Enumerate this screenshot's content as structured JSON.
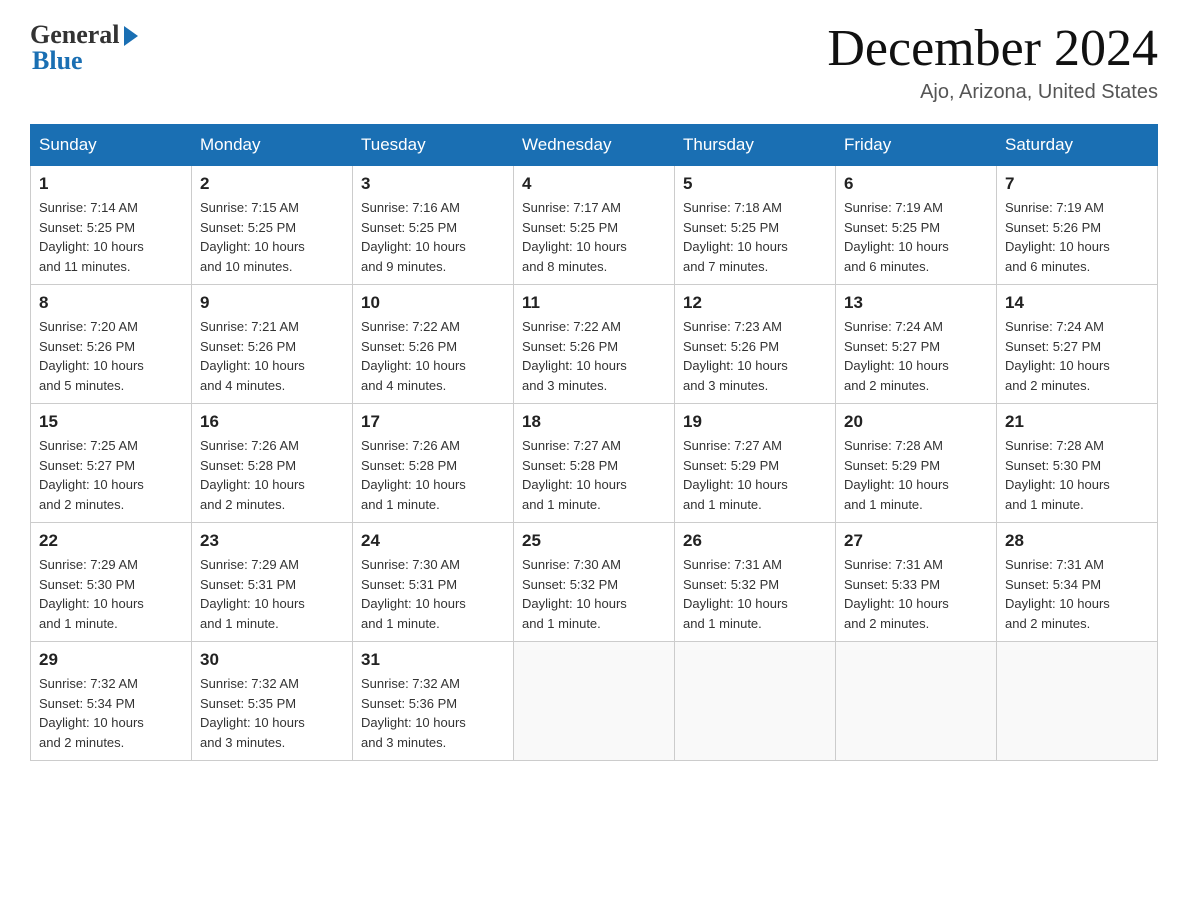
{
  "header": {
    "logo_general": "General",
    "logo_blue": "Blue",
    "month_title": "December 2024",
    "location": "Ajo, Arizona, United States"
  },
  "days_of_week": [
    "Sunday",
    "Monday",
    "Tuesday",
    "Wednesday",
    "Thursday",
    "Friday",
    "Saturday"
  ],
  "weeks": [
    [
      {
        "day": "1",
        "sunrise": "7:14 AM",
        "sunset": "5:25 PM",
        "daylight": "10 hours and 11 minutes."
      },
      {
        "day": "2",
        "sunrise": "7:15 AM",
        "sunset": "5:25 PM",
        "daylight": "10 hours and 10 minutes."
      },
      {
        "day": "3",
        "sunrise": "7:16 AM",
        "sunset": "5:25 PM",
        "daylight": "10 hours and 9 minutes."
      },
      {
        "day": "4",
        "sunrise": "7:17 AM",
        "sunset": "5:25 PM",
        "daylight": "10 hours and 8 minutes."
      },
      {
        "day": "5",
        "sunrise": "7:18 AM",
        "sunset": "5:25 PM",
        "daylight": "10 hours and 7 minutes."
      },
      {
        "day": "6",
        "sunrise": "7:19 AM",
        "sunset": "5:25 PM",
        "daylight": "10 hours and 6 minutes."
      },
      {
        "day": "7",
        "sunrise": "7:19 AM",
        "sunset": "5:26 PM",
        "daylight": "10 hours and 6 minutes."
      }
    ],
    [
      {
        "day": "8",
        "sunrise": "7:20 AM",
        "sunset": "5:26 PM",
        "daylight": "10 hours and 5 minutes."
      },
      {
        "day": "9",
        "sunrise": "7:21 AM",
        "sunset": "5:26 PM",
        "daylight": "10 hours and 4 minutes."
      },
      {
        "day": "10",
        "sunrise": "7:22 AM",
        "sunset": "5:26 PM",
        "daylight": "10 hours and 4 minutes."
      },
      {
        "day": "11",
        "sunrise": "7:22 AM",
        "sunset": "5:26 PM",
        "daylight": "10 hours and 3 minutes."
      },
      {
        "day": "12",
        "sunrise": "7:23 AM",
        "sunset": "5:26 PM",
        "daylight": "10 hours and 3 minutes."
      },
      {
        "day": "13",
        "sunrise": "7:24 AM",
        "sunset": "5:27 PM",
        "daylight": "10 hours and 2 minutes."
      },
      {
        "day": "14",
        "sunrise": "7:24 AM",
        "sunset": "5:27 PM",
        "daylight": "10 hours and 2 minutes."
      }
    ],
    [
      {
        "day": "15",
        "sunrise": "7:25 AM",
        "sunset": "5:27 PM",
        "daylight": "10 hours and 2 minutes."
      },
      {
        "day": "16",
        "sunrise": "7:26 AM",
        "sunset": "5:28 PM",
        "daylight": "10 hours and 2 minutes."
      },
      {
        "day": "17",
        "sunrise": "7:26 AM",
        "sunset": "5:28 PM",
        "daylight": "10 hours and 1 minute."
      },
      {
        "day": "18",
        "sunrise": "7:27 AM",
        "sunset": "5:28 PM",
        "daylight": "10 hours and 1 minute."
      },
      {
        "day": "19",
        "sunrise": "7:27 AM",
        "sunset": "5:29 PM",
        "daylight": "10 hours and 1 minute."
      },
      {
        "day": "20",
        "sunrise": "7:28 AM",
        "sunset": "5:29 PM",
        "daylight": "10 hours and 1 minute."
      },
      {
        "day": "21",
        "sunrise": "7:28 AM",
        "sunset": "5:30 PM",
        "daylight": "10 hours and 1 minute."
      }
    ],
    [
      {
        "day": "22",
        "sunrise": "7:29 AM",
        "sunset": "5:30 PM",
        "daylight": "10 hours and 1 minute."
      },
      {
        "day": "23",
        "sunrise": "7:29 AM",
        "sunset": "5:31 PM",
        "daylight": "10 hours and 1 minute."
      },
      {
        "day": "24",
        "sunrise": "7:30 AM",
        "sunset": "5:31 PM",
        "daylight": "10 hours and 1 minute."
      },
      {
        "day": "25",
        "sunrise": "7:30 AM",
        "sunset": "5:32 PM",
        "daylight": "10 hours and 1 minute."
      },
      {
        "day": "26",
        "sunrise": "7:31 AM",
        "sunset": "5:32 PM",
        "daylight": "10 hours and 1 minute."
      },
      {
        "day": "27",
        "sunrise": "7:31 AM",
        "sunset": "5:33 PM",
        "daylight": "10 hours and 2 minutes."
      },
      {
        "day": "28",
        "sunrise": "7:31 AM",
        "sunset": "5:34 PM",
        "daylight": "10 hours and 2 minutes."
      }
    ],
    [
      {
        "day": "29",
        "sunrise": "7:32 AM",
        "sunset": "5:34 PM",
        "daylight": "10 hours and 2 minutes."
      },
      {
        "day": "30",
        "sunrise": "7:32 AM",
        "sunset": "5:35 PM",
        "daylight": "10 hours and 3 minutes."
      },
      {
        "day": "31",
        "sunrise": "7:32 AM",
        "sunset": "5:36 PM",
        "daylight": "10 hours and 3 minutes."
      },
      null,
      null,
      null,
      null
    ]
  ],
  "labels": {
    "sunrise": "Sunrise:",
    "sunset": "Sunset:",
    "daylight": "Daylight:"
  }
}
